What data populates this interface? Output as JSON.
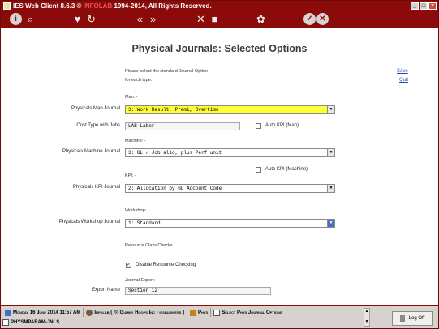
{
  "window": {
    "title_prefix": "IES Web Client 8.6.3 © ",
    "title_brand": "INFOLAB",
    "title_suffix": " 1994-2014, All Rights Reserved.",
    "controls": {
      "minimize": "_",
      "maximize": "□",
      "close": "×"
    }
  },
  "toolbar": {
    "icons": [
      "info-icon",
      "search-icon",
      "favorite-icon",
      "history-icon",
      "back-icon",
      "forward-icon",
      "tools-icon",
      "window-icon",
      "settings-icon",
      "ok-icon",
      "cancel-icon"
    ],
    "glyphs": {
      "info": "i",
      "search": "⌕",
      "favorite": "♥",
      "history": "↻",
      "back": "«",
      "forward": "»",
      "tools": "✕",
      "window": "■",
      "settings": "✿",
      "ok": "✓",
      "cancel": "✕"
    }
  },
  "page": {
    "title": "Physical Journals: Selected Options",
    "instruction_line1": "Please select the standard Journal Option",
    "instruction_line2": "for each type.",
    "save_link": "Save",
    "quit_link": "Quit"
  },
  "form": {
    "man_section": "Man: -",
    "man_journal_label": "Physicals Man Journal",
    "man_journal_value": "3: Work Result, Premi, Overtime",
    "cost_type_label": "Cost Type with Jobs",
    "cost_type_value": "LAB Labor",
    "auto_kpi_man_label": "Auto KPI (Man)",
    "machine_section": "Machine: -",
    "machine_journal_label": "Physicals Machine Journal",
    "machine_journal_value": "3: GL / Job allo, plus Perf unit",
    "auto_kpi_machine_label": "Auto KPI (Machine)",
    "kpi_section": "KPI: -",
    "kpi_journal_label": "Physicals KPI Journal",
    "kpi_journal_value": "2: Allocation by GL Account Code",
    "workshop_section": "Workshop: -",
    "workshop_journal_label": "Physicals Workshop Journal",
    "workshop_journal_value": "1: Standard",
    "resource_section": "Resource Class Checks",
    "disable_resource_label": "Disable Resource Checking",
    "disable_resource_checked": "✓",
    "journal_export_section": "Journal Export: -",
    "export_name_label": "Export Name",
    "export_name_value": "Section 12",
    "dropdown_arrow": "▼"
  },
  "status": {
    "date": "Monday 16 June 2014 11:57 AM",
    "company": "Infolab [ @ Gummy Hoops Inc - iesbusiness ]",
    "module": "Phys",
    "screen": "Select Phys Journal Options",
    "program": "PHYSMPARAM-JNLS",
    "logoff": "Log Off",
    "scroll_up": "▲",
    "scroll_down": "▼"
  },
  "colors": {
    "brand": "#8b0a0a",
    "highlight": "#ffff33",
    "link": "#1e4fa8"
  }
}
